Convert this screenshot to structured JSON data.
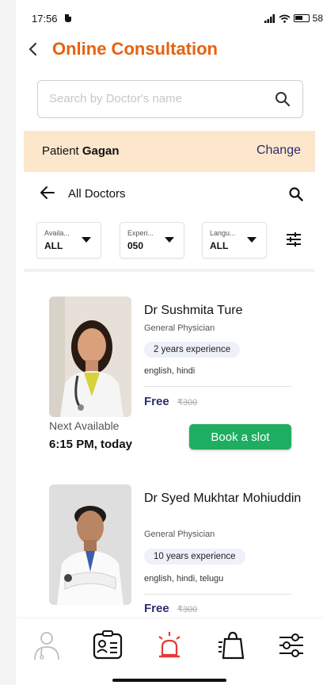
{
  "status_bar": {
    "time": "17:56",
    "battery": "58"
  },
  "header": {
    "title": "Online Consultation"
  },
  "search": {
    "placeholder": "Search by Doctor's name"
  },
  "patient": {
    "label": "Patient",
    "name": "Gagan",
    "change_label": "Change"
  },
  "list_header": {
    "title": "All Doctors"
  },
  "filters": [
    {
      "label": "Availa...",
      "value": "ALL"
    },
    {
      "label": "Experi...",
      "value": "050"
    },
    {
      "label": "Langu...",
      "value": "ALL"
    }
  ],
  "doctors": [
    {
      "name": "Dr Sushmita Ture",
      "specialty": "General Physician",
      "experience": "2 years experience",
      "languages": "english, hindi",
      "price": "Free",
      "original_price": "₹300",
      "next_available_label": "Next Available",
      "next_available_time": "6:15 PM, today",
      "book_label": "Book a slot"
    },
    {
      "name": "Dr Syed Mukhtar Mohiuddin",
      "specialty": "General Physician",
      "experience": "10 years experience",
      "languages": "english, hindi, telugu",
      "price": "Free",
      "original_price": "₹300"
    }
  ],
  "bottom_nav": [
    {
      "icon": "doctor-icon"
    },
    {
      "icon": "id-card-icon"
    },
    {
      "icon": "emergency-siren-icon",
      "color": "#e53935"
    },
    {
      "icon": "shopping-bag-icon"
    },
    {
      "icon": "settings-sliders-icon"
    }
  ],
  "colors": {
    "accent": "#e8610e",
    "primary_dark": "#2c2c74",
    "book_green": "#1eae62",
    "patient_bar": "#fde7cc"
  }
}
